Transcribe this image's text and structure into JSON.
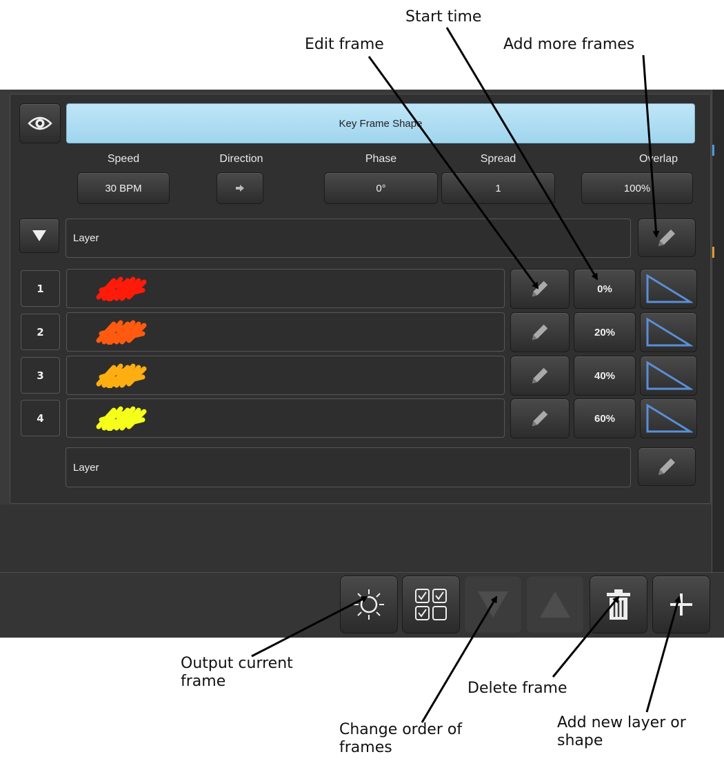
{
  "callouts": {
    "start_time": "Start time",
    "edit_frame": "Edit frame",
    "add_more_frames": "Add more frames",
    "output_current_frame": [
      "Output current",
      "frame"
    ],
    "delete_frame": "Delete frame",
    "change_order": [
      "Change order of",
      "frames"
    ],
    "add_new_layer": [
      "Add new layer or",
      "shape"
    ]
  },
  "header": {
    "title": "Key Frame Shape",
    "eye_icon": "eye-icon"
  },
  "params": {
    "speed_label": "Speed",
    "speed_value": "30 BPM",
    "direction_label": "Direction",
    "direction_icon": "arrow-right-icon",
    "phase_label": "Phase",
    "phase_value": "0°",
    "spread_label": "Spread",
    "spread_value": "1",
    "overlap_label": "Overlap",
    "overlap_value": "100%"
  },
  "layer1": {
    "label": "Layer",
    "toggle_icon": "triangle-down-icon",
    "edit_icon": "pencil-icon"
  },
  "frames": [
    {
      "number": "1",
      "color": "#ff1a0a",
      "start": "0%",
      "edit_icon": "pencil-icon",
      "fade_icon": "ramp-icon"
    },
    {
      "number": "2",
      "color": "#ff5a0f",
      "start": "20%",
      "edit_icon": "pencil-icon",
      "fade_icon": "ramp-icon"
    },
    {
      "number": "3",
      "color": "#ffae12",
      "start": "40%",
      "edit_icon": "pencil-icon",
      "fade_icon": "ramp-icon"
    },
    {
      "number": "4",
      "color": "#f5ff1a",
      "start": "60%",
      "edit_icon": "pencil-icon",
      "fade_icon": "ramp-icon"
    }
  ],
  "layer2": {
    "label": "Layer",
    "edit_icon": "pencil-icon"
  },
  "toolbar": {
    "output_icon": "sun-icon",
    "select_icon": "checkbox-grid-icon",
    "move_down_icon": "triangle-down-icon",
    "move_up_icon": "triangle-up-icon",
    "delete_icon": "trash-icon",
    "add_icon": "plus-icon"
  },
  "colors": {
    "title_bar": "#aadcf2",
    "ramp_line": "#5a8fd8"
  }
}
